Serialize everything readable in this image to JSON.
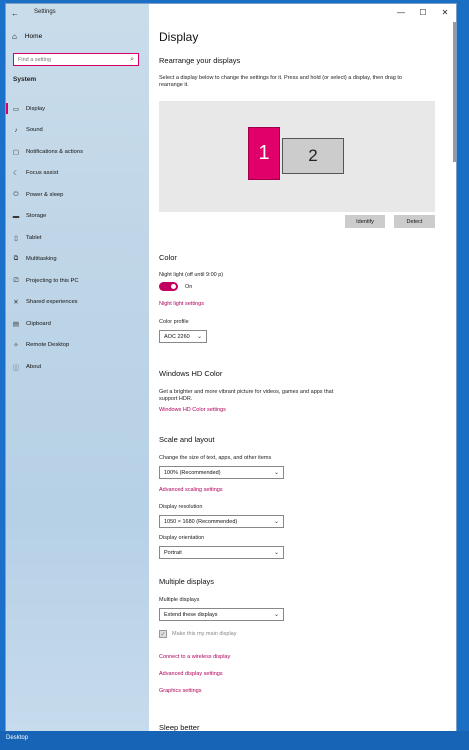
{
  "window": {
    "title": "Settings",
    "minimize": "—",
    "maximize": "☐",
    "close": "✕",
    "back": "←"
  },
  "sidebar": {
    "home_label": "Home",
    "home_icon": "⌂",
    "search_placeholder": "Find a setting",
    "search_icon": "⌕",
    "section": "System",
    "items": [
      {
        "label": "Display",
        "icon": "▭"
      },
      {
        "label": "Sound",
        "icon": "♪"
      },
      {
        "label": "Notifications & actions",
        "icon": "▢"
      },
      {
        "label": "Focus assist",
        "icon": "☾"
      },
      {
        "label": "Power & sleep",
        "icon": "⏻"
      },
      {
        "label": "Storage",
        "icon": "▬"
      },
      {
        "label": "Tablet",
        "icon": "▯"
      },
      {
        "label": "Multitasking",
        "icon": "⧉"
      },
      {
        "label": "Projecting to this PC",
        "icon": "⎚"
      },
      {
        "label": "Shared experiences",
        "icon": "✕"
      },
      {
        "label": "Clipboard",
        "icon": "▤"
      },
      {
        "label": "Remote Desktop",
        "icon": "✧"
      },
      {
        "label": "About",
        "icon": "ⓘ"
      }
    ]
  },
  "main": {
    "title": "Display",
    "rearrange": {
      "heading": "Rearrange your displays",
      "desc1": "Select a display below to change the settings for it. Press and hold (or select) a display, then drag to",
      "desc2": "rearrange it.",
      "monitor1": "1",
      "monitor2": "2",
      "identify": "Identify",
      "detect": "Detect"
    },
    "color": {
      "heading": "Color",
      "night_light_label": "Night light (off until 9:00 p)",
      "toggle_state": "On",
      "night_light_link": "Night light settings",
      "profile_label": "Color profile",
      "profile_value": "AOC 2260"
    },
    "hd_color": {
      "heading": "Windows HD Color",
      "desc1": "Get a brighter and more vibrant picture for videos, games and apps that",
      "desc2": "support HDR.",
      "link": "Windows HD Color settings"
    },
    "scale": {
      "heading": "Scale and layout",
      "size_label": "Change the size of text, apps, and other items",
      "size_value": "100% (Recommended)",
      "advanced_link": "Advanced scaling settings",
      "resolution_label": "Display resolution",
      "resolution_value": "1050 × 1680 (Recommended)",
      "orientation_label": "Display orientation",
      "orientation_value": "Portrait"
    },
    "multiple": {
      "heading": "Multiple displays",
      "label": "Multiple displays",
      "value": "Extend these displays",
      "main_display": "Make this my main display",
      "link_wireless": "Connect to a wireless display",
      "link_advanced": "Advanced display settings",
      "link_graphics": "Graphics settings"
    },
    "sleep_heading": "Sleep better"
  },
  "taskbar": {
    "desktop_label": "Desktop"
  }
}
